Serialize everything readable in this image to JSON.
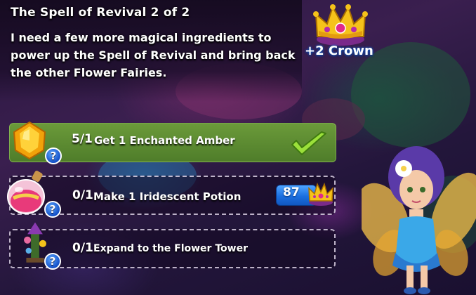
{
  "quest": {
    "title": "The Spell of Revival 2 of 2",
    "description": "I need a few more magical ingredients to power up the Spell of Revival and bring back the other Flower Fairies."
  },
  "reward": {
    "label": "+2 Crown",
    "icon": "crown-icon"
  },
  "tasks": [
    {
      "progress": "5/1",
      "text": "Get 1 Enchanted Amber",
      "icon": "amber-icon",
      "status": "complete",
      "help": "?"
    },
    {
      "progress": "0/1",
      "text": "Make 1 Iridescent Potion",
      "icon": "potion-icon",
      "status": "incomplete",
      "help": "?",
      "skip_cost": "87",
      "skip_icon": "crown-icon"
    },
    {
      "progress": "0/1",
      "text": "Expand to the Flower Tower",
      "icon": "flower-tower-icon",
      "status": "incomplete",
      "help": "?"
    }
  ],
  "colors": {
    "complete_row": "#5a8a30",
    "skip_button": "#1b6fe0",
    "help_badge": "#1450c8",
    "check": "#9be03a"
  }
}
